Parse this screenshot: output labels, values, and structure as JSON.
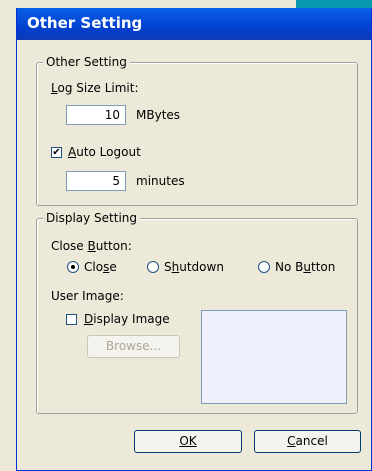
{
  "dialog": {
    "title": "Other Setting"
  },
  "other_group": {
    "legend": "Other Setting",
    "log_size": {
      "label": "Log Size Limit:",
      "value": "10",
      "unit": "MBytes"
    },
    "auto_logout": {
      "label": "Auto Logout",
      "checked": true,
      "value": "5",
      "unit": "minutes"
    }
  },
  "display_group": {
    "legend": "Display Setting",
    "close_button": {
      "label": "Close Button:",
      "options": [
        "Close",
        "Shutdown",
        "No Button"
      ],
      "selected": "Close"
    },
    "user_image": {
      "label": "User Image:",
      "display_image_label": "Display Image",
      "display_image_checked": false,
      "browse_label": "Browse..."
    }
  },
  "buttons": {
    "ok": "OK",
    "cancel": "Cancel"
  }
}
